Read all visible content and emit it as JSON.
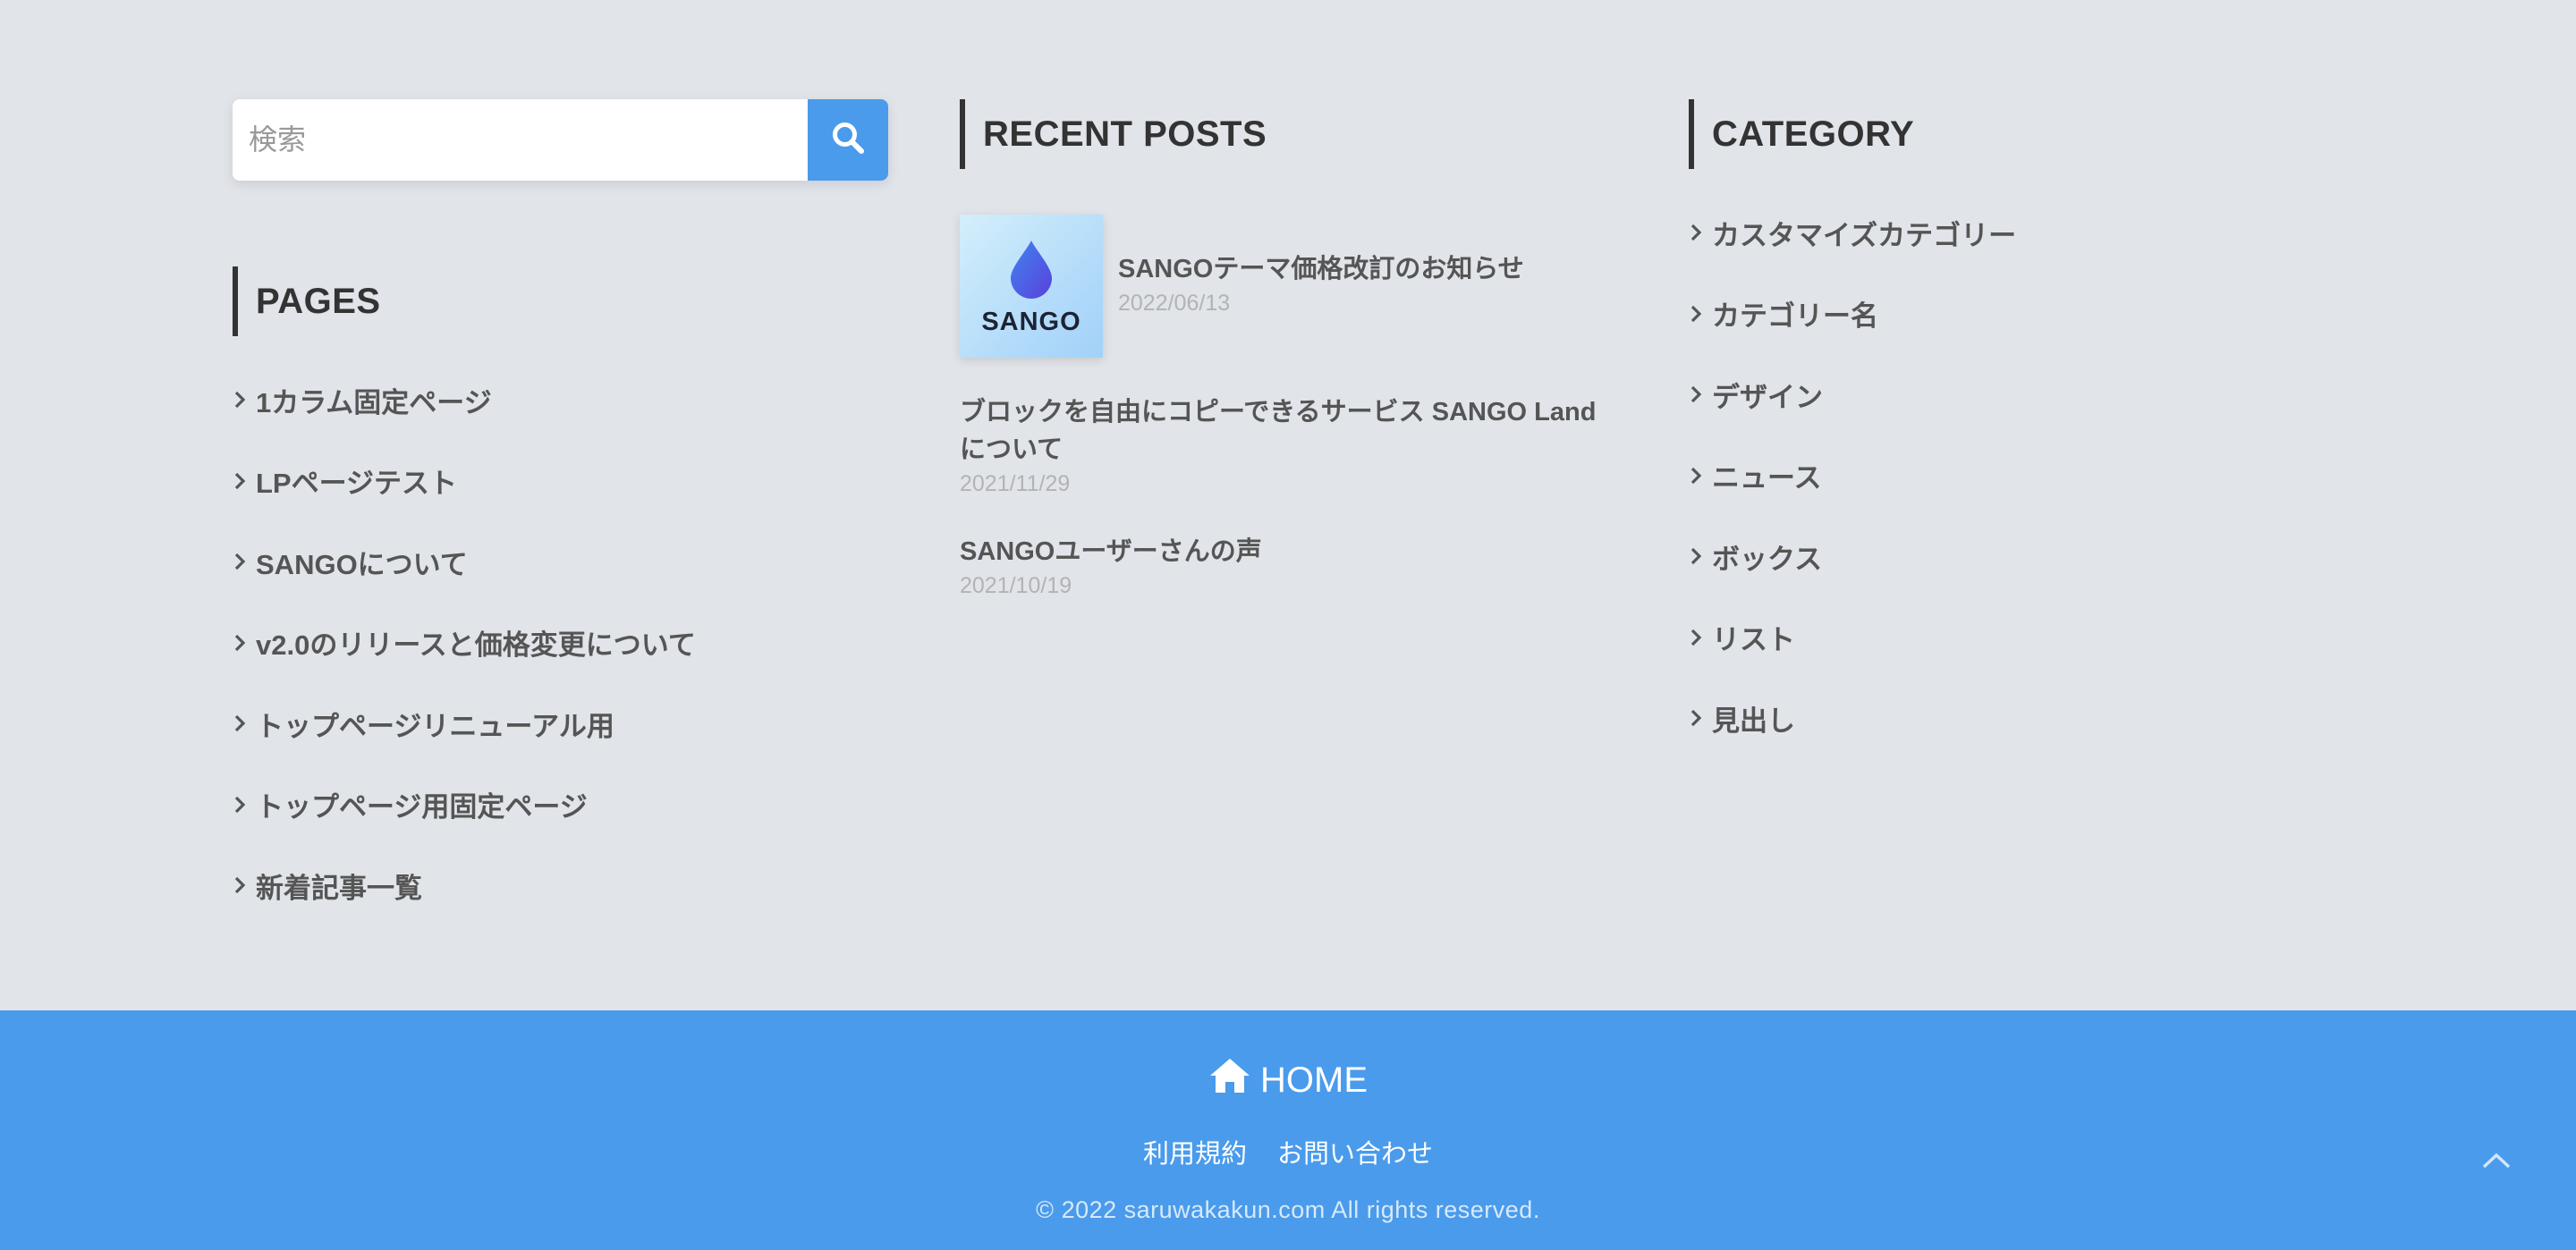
{
  "search": {
    "placeholder": "検索",
    "icon": "search-icon"
  },
  "pages": {
    "title": "PAGES",
    "items": [
      {
        "label": "1カラム固定ページ"
      },
      {
        "label": "LPページテスト"
      },
      {
        "label": "SANGOについて"
      },
      {
        "label": "v2.0のリリースと価格変更について"
      },
      {
        "label": "トップページリニューアル用"
      },
      {
        "label": "トップページ用固定ページ"
      },
      {
        "label": "新着記事一覧"
      }
    ]
  },
  "recent_posts": {
    "title": "RECENT POSTS",
    "posts": [
      {
        "title": "SANGOテーマ価格改訂のお知らせ",
        "date": "2022/06/13",
        "thumb_text": "SANGO"
      },
      {
        "title_line1": "ブロックを自由にコピーできるサービス SANGO Land",
        "title_line2": "について",
        "date": "2021/11/29"
      },
      {
        "title": "SANGOユーザーさんの声",
        "date": "2021/10/19"
      }
    ]
  },
  "category": {
    "title": "CATEGORY",
    "items": [
      {
        "label": "カスタマイズカテゴリー"
      },
      {
        "label": "カテゴリー名"
      },
      {
        "label": "デザイン"
      },
      {
        "label": "ニュース"
      },
      {
        "label": "ボックス"
      },
      {
        "label": "リスト"
      },
      {
        "label": "見出し"
      }
    ]
  },
  "footer": {
    "home_label": "HOME",
    "links": [
      "利用規約",
      "お問い合わせ"
    ],
    "copyright": "© 2022 saruwakakun.com All rights reserved."
  },
  "colors": {
    "background": "#e1e4e9",
    "accent": "#4a9beb",
    "heading": "#333333",
    "text": "#555555",
    "date": "#b3b3b3"
  }
}
